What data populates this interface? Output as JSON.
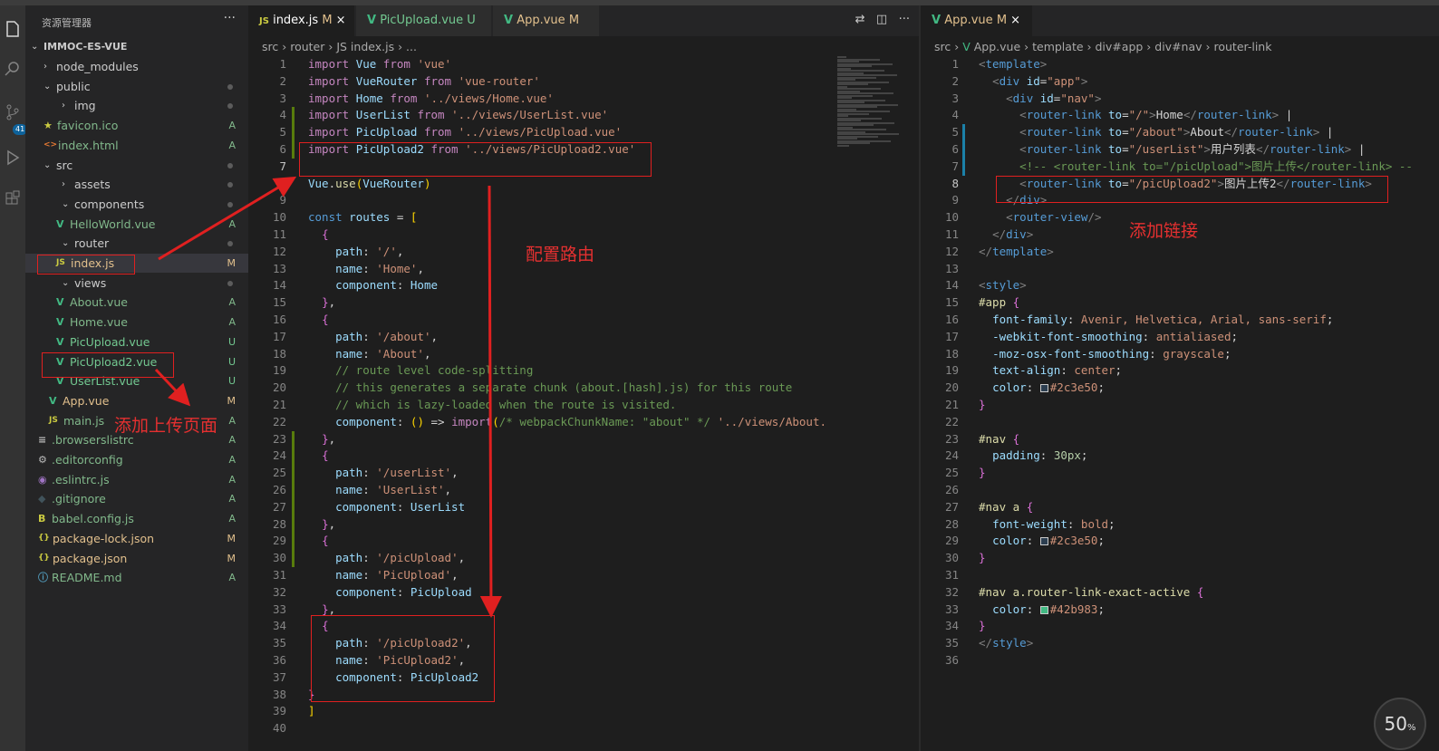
{
  "sidebar": {
    "title": "资源管理器",
    "more": "···",
    "project": "IMMOC-ES-VUE",
    "items": [
      {
        "label": "node_modules",
        "icon": "›",
        "status": ""
      },
      {
        "label": "public",
        "icon": "⌄",
        "status": ""
      },
      {
        "label": "img",
        "icon": "›",
        "status": ""
      },
      {
        "label": "favicon.ico",
        "icon": "★",
        "status": "A"
      },
      {
        "label": "index.html",
        "icon": "<>",
        "status": "A"
      },
      {
        "label": "src",
        "icon": "⌄",
        "status": ""
      },
      {
        "label": "assets",
        "icon": "›",
        "status": ""
      },
      {
        "label": "components",
        "icon": "⌄",
        "status": ""
      },
      {
        "label": "HelloWorld.vue",
        "icon": "V",
        "status": "A"
      },
      {
        "label": "router",
        "icon": "⌄",
        "status": ""
      },
      {
        "label": "index.js",
        "icon": "JS",
        "status": "M"
      },
      {
        "label": "views",
        "icon": "⌄",
        "status": ""
      },
      {
        "label": "About.vue",
        "icon": "V",
        "status": "A"
      },
      {
        "label": "Home.vue",
        "icon": "V",
        "status": "A"
      },
      {
        "label": "PicUpload.vue",
        "icon": "V",
        "status": "U"
      },
      {
        "label": "PicUpload2.vue",
        "icon": "V",
        "status": "U"
      },
      {
        "label": "UserList.vue",
        "icon": "V",
        "status": "U"
      },
      {
        "label": "App.vue",
        "icon": "V",
        "status": "M"
      },
      {
        "label": "main.js",
        "icon": "JS",
        "status": "A"
      },
      {
        "label": ".browserslistrc",
        "icon": "≡",
        "status": "A"
      },
      {
        "label": ".editorconfig",
        "icon": "⚙",
        "status": "A"
      },
      {
        "label": ".eslintrc.js",
        "icon": "◉",
        "status": "A"
      },
      {
        "label": ".gitignore",
        "icon": "◆",
        "status": "A"
      },
      {
        "label": "babel.config.js",
        "icon": "B",
        "status": "A"
      },
      {
        "label": "package-lock.json",
        "icon": "{}",
        "status": "M"
      },
      {
        "label": "package.json",
        "icon": "{}",
        "status": "M"
      },
      {
        "label": "README.md",
        "icon": "ⓘ",
        "status": "A"
      }
    ]
  },
  "activity": {
    "badge": "41"
  },
  "editor1": {
    "tabs": [
      {
        "icon": "JS",
        "label": "index.js",
        "status": "M",
        "close": "×"
      },
      {
        "icon": "V",
        "label": "PicUpload.vue",
        "status": "U",
        "close": ""
      },
      {
        "icon": "V",
        "label": "App.vue",
        "status": "M",
        "close": ""
      }
    ],
    "breadcrumb": [
      "src",
      "router",
      "JS index.js",
      "..."
    ],
    "lines": [
      "import Vue from 'vue'",
      "import VueRouter from 'vue-router'",
      "import Home from '../views/Home.vue'",
      "import UserList from '../views/UserList.vue'",
      "import PicUpload from '../views/PicUpload.vue'",
      "import PicUpload2 from '../views/PicUpload2.vue'",
      "",
      "Vue.use(VueRouter)",
      "",
      "const routes = [",
      "  {",
      "    path: '/',",
      "    name: 'Home',",
      "    component: Home",
      "  },",
      "  {",
      "    path: '/about',",
      "    name: 'About',",
      "    // route level code-splitting",
      "    // this generates a separate chunk (about.[hash].js) for this route",
      "    // which is lazy-loaded when the route is visited.",
      "    component: () => import(/* webpackChunkName: \"about\" */ '../views/About.",
      "  },",
      "  {",
      "    path: '/userList',",
      "    name: 'UserList',",
      "    component: UserList",
      "  },",
      "  {",
      "    path: '/picUpload',",
      "    name: 'PicUpload',",
      "    component: PicUpload",
      "  },",
      "  {",
      "    path: '/picUpload2',",
      "    name: 'PicUpload2',",
      "    component: PicUpload2",
      "  }",
      "]",
      ""
    ]
  },
  "editor2": {
    "tabs": [
      {
        "icon": "V",
        "label": "App.vue",
        "status": "M",
        "close": "×"
      }
    ],
    "breadcrumb": [
      "src",
      "App.vue",
      "template",
      "div#app",
      "div#nav",
      "router-link"
    ],
    "lines": [
      "<template>",
      "  <div id=\"app\">",
      "    <div id=\"nav\">",
      "      <router-link to=\"/\">Home</router-link> |",
      "      <router-link to=\"/about\">About</router-link> |",
      "      <router-link to=\"/userList\">用户列表</router-link> |",
      "      <!-- <router-link to=\"/picUpload\">图片上传</router-link> --",
      "      <router-link to=\"/picUpload2\">图片上传2</router-link>",
      "    </div>",
      "    <router-view/>",
      "  </div>",
      "</template>",
      "",
      "<style>",
      "#app {",
      "  font-family: Avenir, Helvetica, Arial, sans-serif;",
      "  -webkit-font-smoothing: antialiased;",
      "  -moz-osx-font-smoothing: grayscale;",
      "  text-align: center;",
      "  color: #2c3e50;",
      "}",
      "",
      "#nav {",
      "  padding: 30px;",
      "}",
      "",
      "#nav a {",
      "  font-weight: bold;",
      "  color: #2c3e50;",
      "}",
      "",
      "#nav a.router-link-exact-active {",
      "  color: #42b983;",
      "}",
      "</style>",
      ""
    ]
  },
  "annotations": {
    "add_page": "添加上传页面",
    "config_route": "配置路由",
    "add_link": "添加链接"
  },
  "zoom": {
    "value": "50",
    "unit": "%"
  },
  "colors": {
    "vue_green": "#42b983",
    "text_dark": "#2c3e50",
    "annotation_red": "#e53030",
    "js_yellow": "#cbcb41"
  }
}
